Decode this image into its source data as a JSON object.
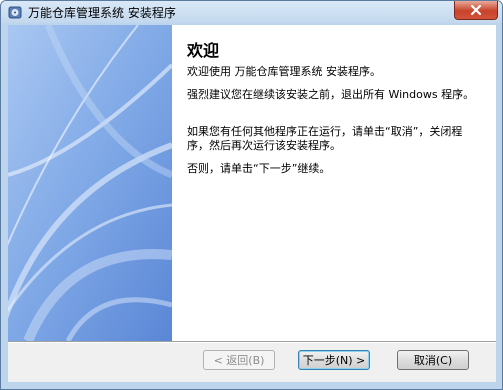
{
  "window": {
    "title": "万能仓库管理系统 安装程序"
  },
  "content": {
    "heading": "欢迎",
    "paragraphs": [
      "欢迎使用 万能仓库管理系统  安装程序。",
      "强烈建议您在继续该安装之前，退出所有 Windows 程序。",
      "如果您有任何其他程序正在运行，请单击“取消”，关闭程序，然后再次运行该安装程序。",
      "否则，请单击“下一步”继续。"
    ]
  },
  "buttons": {
    "back": "< 返回(B)",
    "next": "下一步(N) >",
    "cancel": "取消(C)"
  },
  "colors": {
    "accent": "#8fb3ea",
    "close": "#c8432a"
  },
  "icons": {
    "app": "setup-disk-icon",
    "close": "close-x-icon"
  }
}
